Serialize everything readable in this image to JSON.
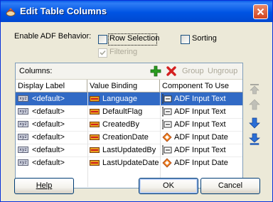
{
  "window": {
    "title": "Edit Table Columns"
  },
  "behavior": {
    "label": "Enable ADF Behavior:",
    "row_selection": "Row Selection",
    "sorting": "Sorting",
    "filtering": "Filtering"
  },
  "columns_panel": {
    "label": "Columns:",
    "group": "Group",
    "ungroup": "Ungroup",
    "headers": [
      "Display Label",
      "Value Binding",
      "Component To Use"
    ],
    "rows": [
      {
        "label": "<default>",
        "binding": "Language",
        "component": "ADF Input Text",
        "component_icon": "input-text-icon"
      },
      {
        "label": "<default>",
        "binding": "DefaultFlag",
        "component": "ADF Input Text",
        "component_icon": "input-text-icon"
      },
      {
        "label": "<default>",
        "binding": "CreatedBy",
        "component": "ADF Input Text",
        "component_icon": "input-text-icon"
      },
      {
        "label": "<default>",
        "binding": "CreationDate",
        "component": "ADF Input Date",
        "component_icon": "input-date-icon"
      },
      {
        "label": "<default>",
        "binding": "LastUpdatedBy",
        "component": "ADF Input Text",
        "component_icon": "input-text-icon"
      },
      {
        "label": "<default>",
        "binding": "LastUpdateDate",
        "component": "ADF Input Date",
        "component_icon": "input-date-icon"
      }
    ]
  },
  "buttons": {
    "help": "Help",
    "ok": "OK",
    "cancel": "Cancel"
  },
  "colors": {
    "selection": "#316ac5",
    "title_bar": "#0054e3",
    "add": "#2a9d1f",
    "delete": "#d42020",
    "arrow_blue": "#2b6fd6"
  }
}
